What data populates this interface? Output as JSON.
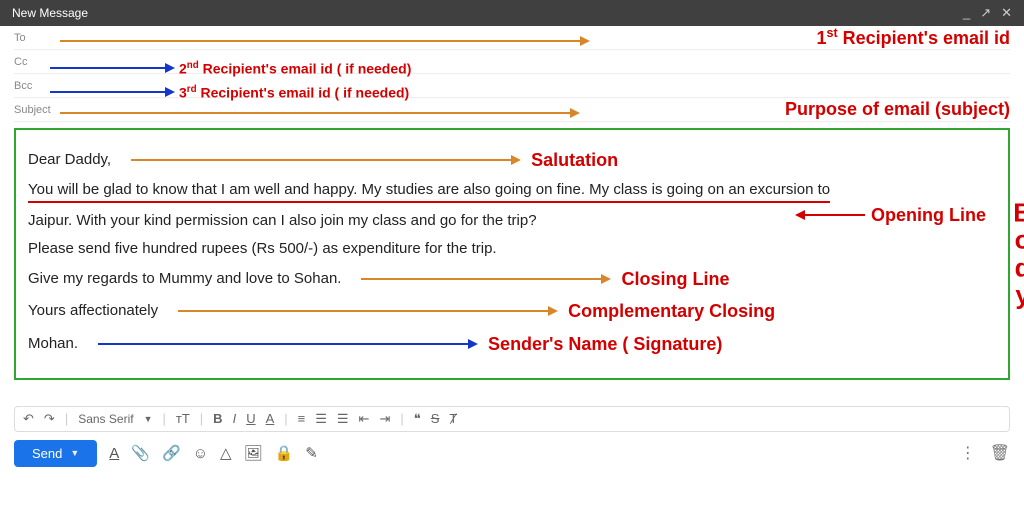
{
  "window": {
    "title": "New Message"
  },
  "fields": {
    "to_label": "To",
    "cc_label": "Cc",
    "bcc_label": "Bcc",
    "subject_label": "Subject"
  },
  "annotations": {
    "to": "1st Recipient's email id",
    "cc": "2nd Recipient's email id ( if needed)",
    "bcc": "3rd Recipient's email id ( if needed)",
    "subject": "Purpose of email (subject)",
    "salutation": "Salutation",
    "opening": "Opening Line",
    "closing": "Closing Line",
    "complementary": "Complementary Closing",
    "signature": "Sender's Name ( Signature)",
    "body_vertical": "Body"
  },
  "email_body": {
    "salutation": "Dear Daddy,",
    "opening_line": "You will be glad to know that I am well and happy. My studies are also going on fine. My class is going on an excursion to",
    "line2": "Jaipur. With your kind permission can I also join my class and go for the trip?",
    "line3": "Please send five hundred rupees (Rs 500/-) as expenditure for the trip.",
    "closing_line": "Give my regards to Mummy and love to Sohan.",
    "complementary": "Yours affectionately",
    "signature": "Mohan."
  },
  "toolbar": {
    "font": "Sans Serif",
    "send": "Send"
  },
  "colors": {
    "orange": "#d7872a",
    "blue": "#1537c8",
    "red": "#d40000"
  }
}
